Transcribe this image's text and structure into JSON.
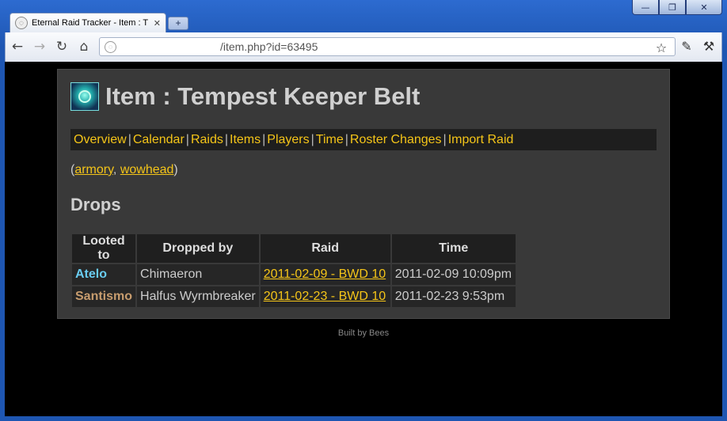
{
  "browser": {
    "tab_title": "Eternal Raid Tracker - Item : T",
    "new_tab_label": "+",
    "url": "/item.php?id=63495",
    "window_buttons": [
      "—",
      "❐",
      "✕"
    ]
  },
  "page": {
    "title": "Item : Tempest Keeper Belt",
    "icon": "item-belt-icon",
    "nav": [
      "Overview",
      "Calendar",
      "Raids",
      "Items",
      "Players",
      "Time",
      "Roster Changes",
      "Import Raid"
    ],
    "nav_separator": "|",
    "ext_links": {
      "open": "(",
      "armory": "armory",
      "comma": ", ",
      "wowhead": "wowhead",
      "close": ")"
    },
    "drops_heading": "Drops",
    "table": {
      "headers": [
        "Looted to",
        "Dropped by",
        "Raid",
        "Time"
      ],
      "rows": [
        {
          "player": "Atelo",
          "player_color": "#69ccf0",
          "dropped_by": "Chimaeron",
          "raid": "2011-02-09 - BWD 10",
          "time": "2011-02-09 10:09pm"
        },
        {
          "player": "Santismo",
          "player_color": "#c79c6e",
          "dropped_by": "Halfus Wyrmbreaker",
          "raid": "2011-02-23 - BWD 10",
          "time": "2011-02-23 9:53pm"
        }
      ]
    },
    "footer": "Built by Bees"
  },
  "colors": {
    "link": "#f5c518",
    "background": "#000000",
    "panel": "#393939"
  }
}
